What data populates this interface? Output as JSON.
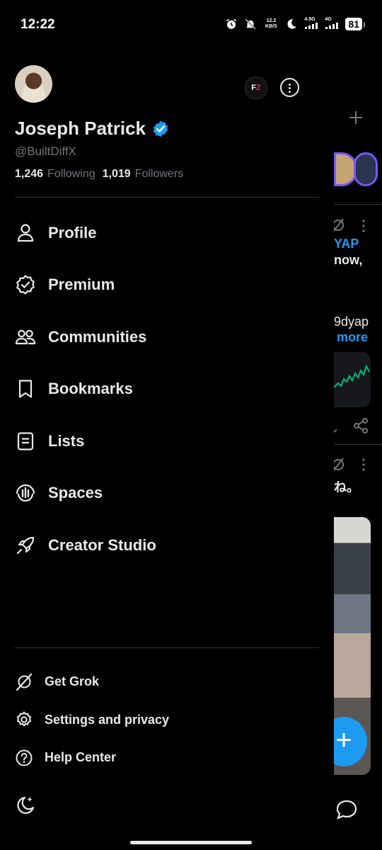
{
  "status_bar": {
    "time": "12:22",
    "speed_value": "12.2",
    "speed_unit": "KB/S",
    "network_1": "4.5G",
    "network_2": "4G",
    "battery": "81"
  },
  "profile": {
    "display_name": "Joseph Patrick",
    "handle": "@BuiltDiffX",
    "following_count": "1,246",
    "following_label": "Following",
    "followers_count": "1,019",
    "followers_label": "Followers",
    "verified_color": "#1d9bf0"
  },
  "menu": {
    "items": [
      {
        "label": "Profile",
        "icon": "person-icon"
      },
      {
        "label": "Premium",
        "icon": "premium-badge-icon"
      },
      {
        "label": "Communities",
        "icon": "communities-icon"
      },
      {
        "label": "Bookmarks",
        "icon": "bookmark-icon"
      },
      {
        "label": "Lists",
        "icon": "list-icon"
      },
      {
        "label": "Spaces",
        "icon": "spaces-icon"
      },
      {
        "label": "Creator Studio",
        "icon": "rocket-icon"
      }
    ]
  },
  "secondary_menu": {
    "items": [
      {
        "label": "Get Grok",
        "icon": "grok-icon"
      },
      {
        "label": "Settings and privacy",
        "icon": "gear-icon"
      },
      {
        "label": "Help Center",
        "icon": "help-icon"
      }
    ]
  },
  "background": {
    "text_1": "YAP",
    "text_2": "now,",
    "text_3": "9dyap",
    "text_4": "more",
    "text_5": "ね。",
    "accent": "#1d9bf0"
  }
}
